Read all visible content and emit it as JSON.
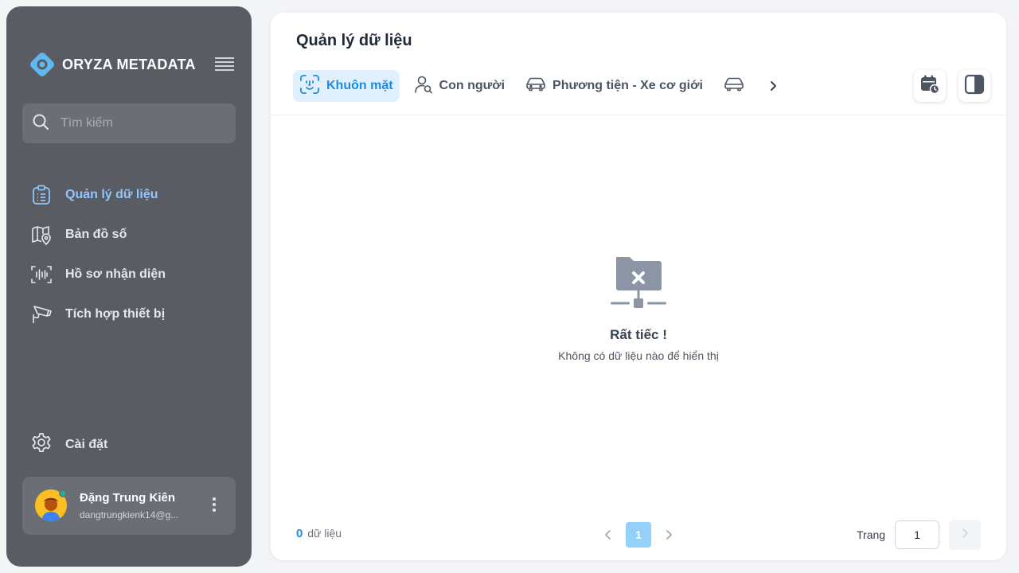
{
  "brand": {
    "name": "ORYZA METADATA"
  },
  "sidebar": {
    "search_placeholder": "Tìm kiếm",
    "items": [
      {
        "label": "Quản lý dữ liệu",
        "icon": "clipboard-list-icon",
        "active": true
      },
      {
        "label": "Bản đồ số",
        "icon": "map-pin-icon",
        "active": false
      },
      {
        "label": "Hồ sơ nhận diện",
        "icon": "voice-scan-icon",
        "active": false
      },
      {
        "label": "Tích hợp thiết bị",
        "icon": "cctv-camera-icon",
        "active": false
      }
    ],
    "settings_label": "Cài đặt",
    "user": {
      "name": "Đặng Trung Kiên",
      "email": "dangtrungkienk14@g..."
    }
  },
  "main": {
    "title": "Quản lý dữ liệu",
    "tabs": [
      {
        "label": "Khuôn mặt",
        "icon": "face-scan-icon",
        "active": true
      },
      {
        "label": "Con người",
        "icon": "person-search-icon",
        "active": false
      },
      {
        "label": "Phương tiện - Xe cơ giới",
        "icon": "car-icon",
        "active": false
      },
      {
        "label": "",
        "icon": "car-icon",
        "active": false
      }
    ],
    "empty": {
      "title": "Rất tiếc !",
      "description": "Không có dữ liệu nào để hiển thị"
    },
    "footer": {
      "count": "0",
      "count_label": "dữ liệu",
      "current_page": "1",
      "page_label": "Trang",
      "page_input_value": "1"
    }
  },
  "colors": {
    "sidebar_bg": "#595d63",
    "accent": "#1d8ce0",
    "active_nav": "#93c5fd",
    "logo": "#60b8f0"
  }
}
